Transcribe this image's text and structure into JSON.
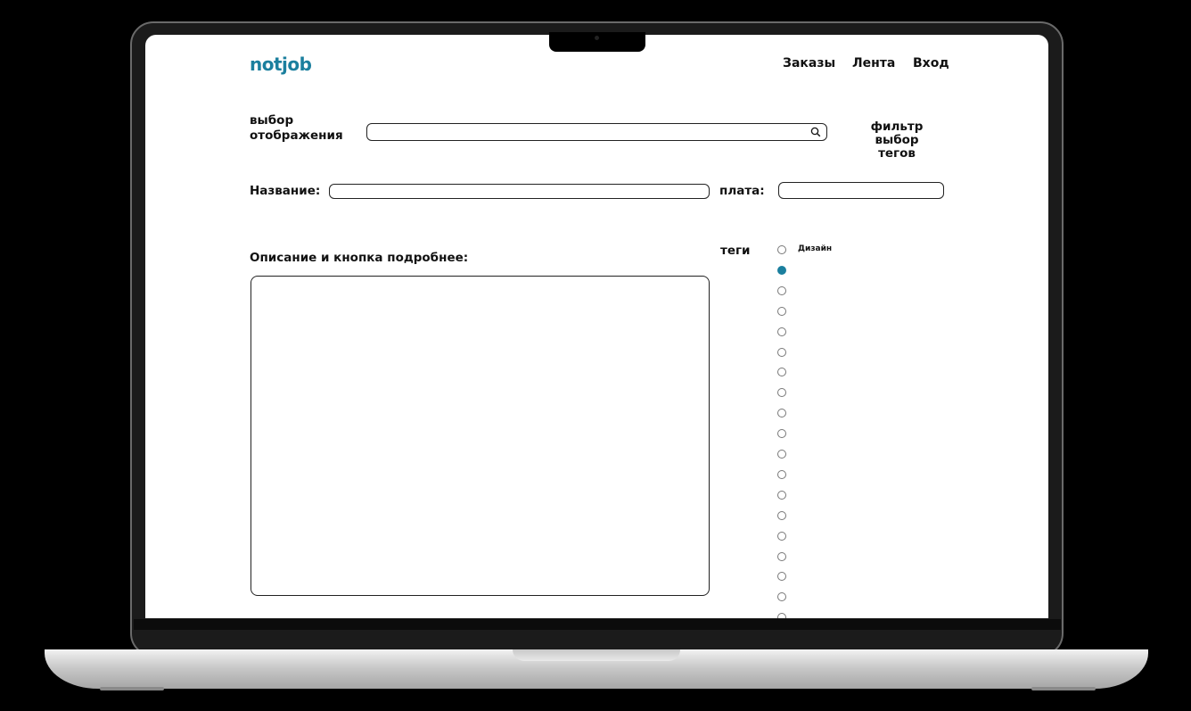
{
  "header": {
    "logo": "notjob",
    "nav": [
      "Заказы",
      "Лента",
      "Вход"
    ]
  },
  "toolbar": {
    "view_select_line1": "выбор",
    "view_select_line2": "отображения",
    "search_value": "",
    "filter_line1": "фильтр",
    "filter_line2": "выбор тегов"
  },
  "form": {
    "name_label": "Название:",
    "name_value": "",
    "pay_label": "плата:",
    "pay_value": "",
    "desc_label": "Описание и кнопка подробнее:",
    "desc_value": ""
  },
  "tags": {
    "label": "теги",
    "first_tag": "Дизайн",
    "selected_index": 1,
    "count": 19
  },
  "colors": {
    "accent": "#1b7f9e"
  }
}
